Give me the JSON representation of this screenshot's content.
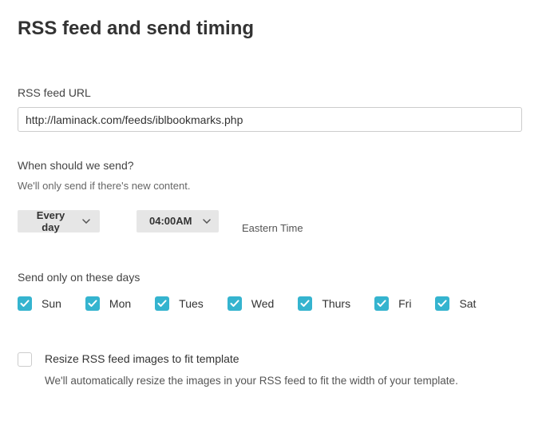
{
  "title": "RSS feed and send timing",
  "url_field": {
    "label": "RSS feed URL",
    "value": "http://laminack.com/feeds/iblbookmarks.php"
  },
  "send_schedule": {
    "label": "When should we send?",
    "sub": "We'll only send if there's new content.",
    "frequency": "Every day",
    "time": "04:00AM",
    "timezone": "Eastern Time"
  },
  "days": {
    "label": "Send only on these days",
    "items": [
      {
        "label": "Sun",
        "checked": true
      },
      {
        "label": "Mon",
        "checked": true
      },
      {
        "label": "Tues",
        "checked": true
      },
      {
        "label": "Wed",
        "checked": true
      },
      {
        "label": "Thurs",
        "checked": true
      },
      {
        "label": "Fri",
        "checked": true
      },
      {
        "label": "Sat",
        "checked": true
      }
    ]
  },
  "resize": {
    "checked": false,
    "label": "Resize RSS feed images to fit template",
    "sub": "We'll automatically resize the images in your RSS feed to fit the width of your template."
  }
}
